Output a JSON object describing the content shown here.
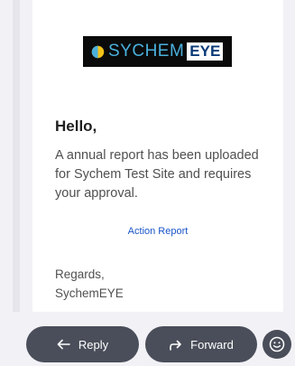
{
  "email": {
    "logo": {
      "word": "SYCHEM",
      "eye": "EYE"
    },
    "greeting": "Hello,",
    "message": "A annual report has been uploaded for Sychem Test Site and requires your approval.",
    "action_link": "Action Report",
    "regards_line1": "Regards,",
    "regards_line2": "SychemEYE"
  },
  "actions": {
    "reply_label": "Reply",
    "forward_label": "Forward"
  },
  "icons": [
    "reply-icon",
    "forward-icon",
    "emoji-icon"
  ],
  "colors": {
    "background": "#f2f1f6",
    "card": "#ffffff",
    "pill": "#4a4e5a",
    "link": "#1a55c8",
    "logo_blue": "#4ab0dc",
    "logo_yellow": "#f2c21a"
  }
}
